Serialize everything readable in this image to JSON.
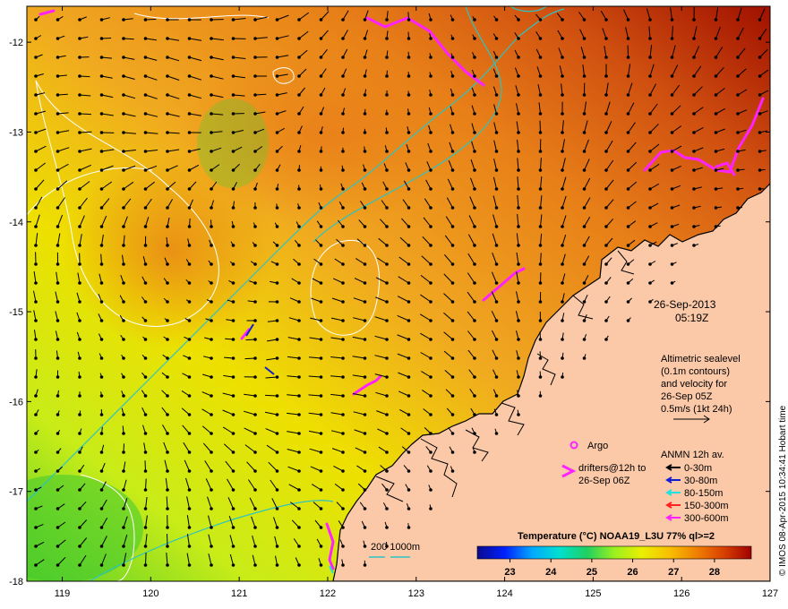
{
  "map": {
    "lon_range": [
      118.6,
      127.0
    ],
    "lat_range": [
      -18.0,
      -11.6
    ],
    "x_ticks": [
      "119",
      "120",
      "121",
      "122",
      "123",
      "124",
      "125",
      "126",
      "127"
    ],
    "y_ticks": [
      "-12",
      "-13",
      "-14",
      "-15",
      "-16",
      "-17",
      "-18"
    ],
    "colors": {
      "land": "#fbc9a8",
      "frame": "#000000",
      "contour_sea": "#ffffff",
      "bathy": "#2fc3c0",
      "drifter": "#ff22ff",
      "argo": "#ff22ff"
    }
  },
  "labels": {
    "date": "26-Sep-2013",
    "time": "05:19Z",
    "altimetry_lines": [
      "Altimetric sealevel",
      "(0.1m contours)",
      "and velocity for",
      "26-Sep 05Z",
      "0.5m/s (1kt 24h)"
    ],
    "argo": "Argo",
    "drifters_lines": [
      "drifters@12h to",
      "26-Sep 06Z"
    ],
    "anmn_title": "ANMN 12h av.",
    "anmn_items": [
      {
        "label": "0-30m",
        "color": "#000000"
      },
      {
        "label": "30-80m",
        "color": "#1020d0"
      },
      {
        "label": "80-150m",
        "color": "#20e0e0"
      },
      {
        "label": "150-300m",
        "color": "#ff2020"
      },
      {
        "label": "300-600m",
        "color": "#ff22ff"
      }
    ],
    "bathy_label": "200  1000m",
    "colorbar_title": "Temperature (°C) NOAA19_L3U 77% ql>=2",
    "colorbar_ticks": [
      "23",
      "24",
      "25",
      "26",
      "27",
      "28"
    ],
    "credit": "© IMOS 08-Apr-2015 10:34:41 Hobart time"
  },
  "colorbar": {
    "range": [
      22.2,
      28.9
    ],
    "stops": [
      "#0a0a8c",
      "#0020ff",
      "#00a8ff",
      "#00e0d0",
      "#20d060",
      "#9af020",
      "#eaf000",
      "#f8c000",
      "#f08000",
      "#d84000",
      "#a00000"
    ]
  }
}
